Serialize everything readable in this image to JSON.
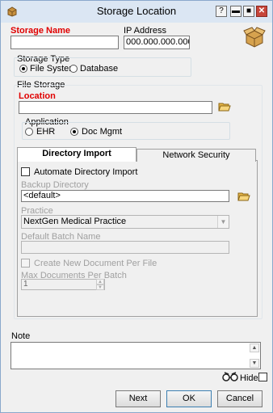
{
  "window": {
    "title": "Storage Location",
    "controls": {
      "help": "?",
      "minimize": "▬",
      "maximize": "■",
      "close": "✕"
    }
  },
  "storage_name": {
    "label": "Storage Name",
    "value": ""
  },
  "ip_address": {
    "label": "IP Address",
    "value": "000.000.000.000"
  },
  "storage_type": {
    "label": "Storage Type",
    "options": [
      {
        "label": "File System",
        "selected": true
      },
      {
        "label": "Database",
        "selected": false
      }
    ]
  },
  "file_storage": {
    "label": "File Storage",
    "location": {
      "label": "Location",
      "value": ""
    },
    "application": {
      "label": "Application",
      "options": [
        {
          "label": "EHR",
          "selected": false
        },
        {
          "label": "Doc Mgmt",
          "selected": true
        }
      ]
    }
  },
  "tabs": [
    {
      "label": "Directory Import",
      "active": true
    },
    {
      "label": "Network Security",
      "active": false
    }
  ],
  "directory_import": {
    "automate_label": "Automate Directory Import",
    "backup_directory": {
      "label": "Backup Directory",
      "value": "<default>"
    },
    "practice": {
      "label": "Practice",
      "value": "NextGen Medical Practice"
    },
    "default_batch_name": {
      "label": "Default Batch Name",
      "value": ""
    },
    "create_new_doc_label": "Create New Document Per File",
    "max_docs": {
      "label": "Max Documents Per Batch",
      "value": "1"
    }
  },
  "note": {
    "label": "Note",
    "value": ""
  },
  "hide_label": "Hide",
  "buttons": {
    "next": "Next",
    "ok": "OK",
    "cancel": "Cancel"
  },
  "icons": {
    "app": "box-icon",
    "storage": "open-box-icon",
    "folder": "folder-open-icon",
    "hide": "glasses-icon"
  },
  "colors": {
    "required_label": "#e00000",
    "title_bar": "#dbe6f3"
  }
}
